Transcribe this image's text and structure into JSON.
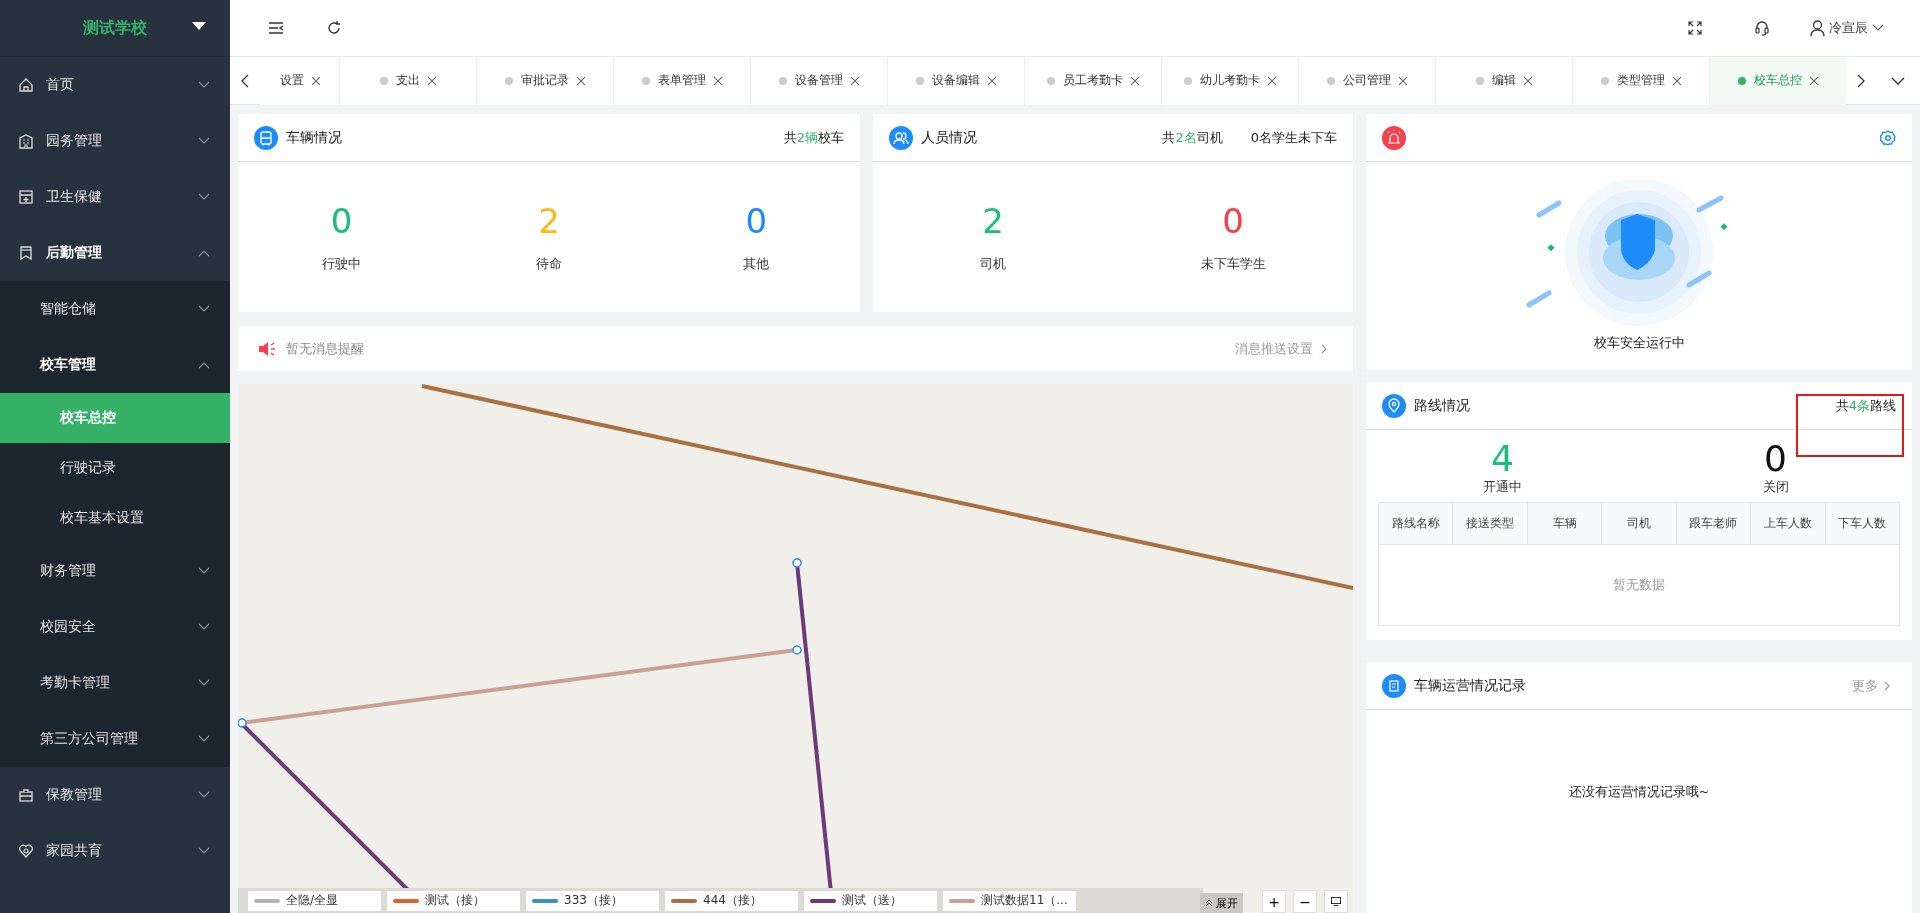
{
  "sidebar": {
    "school": "测试学校",
    "items": [
      {
        "label": "首页",
        "expanded": false,
        "selected": false
      },
      {
        "label": "园务管理",
        "expanded": false,
        "selected": false
      },
      {
        "label": "卫生保健",
        "expanded": false,
        "selected": false
      },
      {
        "label": "后勤管理",
        "expanded": true,
        "selected": false,
        "children": [
          {
            "label": "智能仓储",
            "expanded": false,
            "selected": false
          },
          {
            "label": "校车管理",
            "expanded": true,
            "selected": false,
            "children": [
              {
                "label": "校车总控",
                "selected": true
              },
              {
                "label": "行驶记录",
                "selected": false
              },
              {
                "label": "校车基本设置",
                "selected": false
              }
            ]
          },
          {
            "label": "财务管理",
            "expanded": false,
            "selected": false
          },
          {
            "label": "校园安全",
            "expanded": false,
            "selected": false
          },
          {
            "label": "考勤卡管理",
            "expanded": false,
            "selected": false
          },
          {
            "label": "第三方公司管理",
            "expanded": false,
            "selected": false
          }
        ]
      },
      {
        "label": "保教管理",
        "expanded": false,
        "selected": false
      },
      {
        "label": "家园共育",
        "expanded": false,
        "selected": false
      }
    ]
  },
  "topbar": {
    "user": "冷宣辰"
  },
  "tabs": [
    {
      "label": "设置",
      "dot": false,
      "selected": false
    },
    {
      "label": "支出",
      "dot": true,
      "selected": false
    },
    {
      "label": "审批记录",
      "dot": true,
      "selected": false
    },
    {
      "label": "表单管理",
      "dot": true,
      "selected": false
    },
    {
      "label": "设备管理",
      "dot": true,
      "selected": false
    },
    {
      "label": "设备编辑",
      "dot": true,
      "selected": false
    },
    {
      "label": "员工考勤卡",
      "dot": true,
      "selected": false
    },
    {
      "label": "幼儿考勤卡",
      "dot": true,
      "selected": false
    },
    {
      "label": "公司管理",
      "dot": true,
      "selected": false
    },
    {
      "label": "编辑",
      "dot": true,
      "selected": false
    },
    {
      "label": "类型管理",
      "dot": true,
      "selected": false
    },
    {
      "label": "校车总控",
      "dot": true,
      "selected": true
    }
  ],
  "vehicles": {
    "title": "车辆情况",
    "summary": [
      {
        "prefix": "共",
        "count": "2辆",
        "suffix": "校车"
      }
    ],
    "stats": [
      {
        "value": "0",
        "label": "行驶中",
        "color": "#19be7b"
      },
      {
        "value": "2",
        "label": "待命",
        "color": "#fdb813"
      },
      {
        "value": "0",
        "label": "其他",
        "color": "#1d8cf8"
      }
    ]
  },
  "people": {
    "title": "人员情况",
    "summary": [
      {
        "prefix": "共",
        "count": "2名",
        "suffix": "司机"
      },
      {
        "suffix": "0名学生未下车"
      }
    ],
    "stats": [
      {
        "value": "2",
        "label": "司机",
        "color": "#19be7b"
      },
      {
        "value": "0",
        "label": "未下车学生",
        "color": "#f5414b"
      }
    ]
  },
  "notice": {
    "message": "暂无消息提醒",
    "link": "消息推送设置"
  },
  "map": {
    "legend": [
      {
        "label": "全隐/全显",
        "color": "#b4b4b4"
      },
      {
        "label": "测试（接）",
        "color": "#e0612f"
      },
      {
        "label": "333（接）",
        "color": "#3a92c4"
      },
      {
        "label": "444（接）",
        "color": "#a87043"
      },
      {
        "label": "测试（送）",
        "color": "#6b3a78"
      },
      {
        "label": "测试数据11（...",
        "color": "#c9a092"
      }
    ],
    "expand": "展开",
    "zoom_in": "+",
    "zoom_out": "−"
  },
  "alarm": {
    "status": "校车安全运行中"
  },
  "routes": {
    "title": "路线情况",
    "summary": {
      "prefix": "共",
      "count": "4条",
      "suffix": "路线",
      "highlighted": true
    },
    "stats": [
      {
        "value": "4",
        "label": "开通中",
        "color": "#19be7b"
      },
      {
        "value": "0",
        "label": "关闭",
        "color": "#111111"
      }
    ],
    "columns": [
      "路线名称",
      "接送类型",
      "车辆",
      "司机",
      "跟车老师",
      "上车人数",
      "下车人数"
    ],
    "empty": "暂无数据"
  },
  "records": {
    "title": "车辆运营情况记录",
    "more": "更多",
    "empty": "还没有运营情况记录哦~"
  }
}
